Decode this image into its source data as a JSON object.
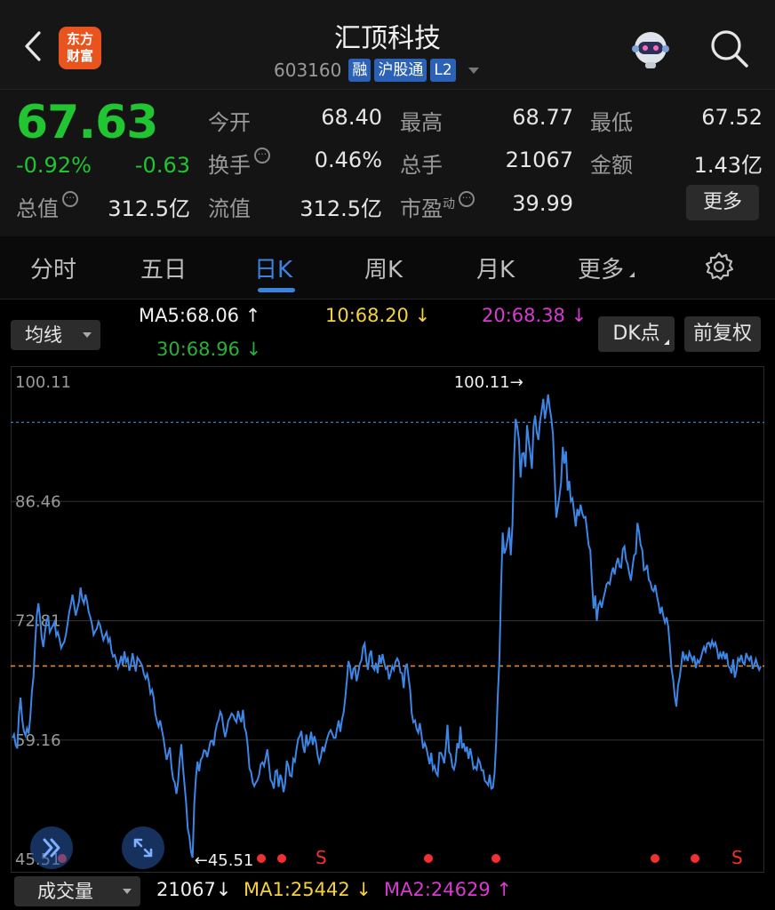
{
  "header": {
    "title": "汇顶科技",
    "code": "603160",
    "tags": [
      "融",
      "沪股通",
      "L2"
    ],
    "logo_text_line1": "东方",
    "logo_text_line2": "财富"
  },
  "quote": {
    "price": "67.63",
    "change_pct": "-0.92%",
    "change": "-0.63",
    "open_label": "今开",
    "open": "68.40",
    "high_label": "最高",
    "high": "68.77",
    "low_label": "最低",
    "low": "67.52",
    "turnover_label": "换手",
    "turnover": "0.46%",
    "volume_label": "总手",
    "volume": "21067",
    "amount_label": "金额",
    "amount": "1.43亿",
    "mktcap_label": "总值",
    "mktcap": "312.5亿",
    "float_label": "流值",
    "float": "312.5亿",
    "pe_label": "市盈",
    "pe_sup": "动",
    "pe": "39.99",
    "more_button": "更多"
  },
  "tabs": [
    "分时",
    "五日",
    "日K",
    "周K",
    "月K",
    "更多"
  ],
  "active_tab": "日K",
  "indicators": {
    "ma_select": "均线",
    "ma5": "MA5:68.06 ↑",
    "ma10": "10:68.20 ↓",
    "ma20": "20:68.38 ↓",
    "ma30": "30:68.96 ↓",
    "dk_button": "DK点",
    "adjust_button": "前复权"
  },
  "chart_data": {
    "type": "line",
    "y_ticks": [
      "100.11",
      "86.46",
      "72.81",
      "59.16",
      "45.51"
    ],
    "ylim": [
      45.51,
      100.11
    ],
    "max_label": "100.11→",
    "min_label": "←45.51",
    "last": 67.63,
    "ref_line": 95.5,
    "signals": [
      "•",
      "•",
      "•",
      "S",
      "•",
      "•",
      "•",
      "•",
      "S"
    ],
    "values": [
      59.4,
      59.8,
      58.6,
      58.2,
      62.1,
      64.0,
      61.5,
      60.2,
      59.7,
      60.5,
      59.9,
      61.8,
      64.7,
      66.4,
      70.3,
      73.4,
      74.8,
      73.2,
      70.9,
      69.8,
      71.4,
      72.8,
      73.3,
      71.5,
      71.9,
      72.3,
      72.7,
      71.1,
      71.5,
      70.7,
      69.7,
      70.1,
      70.4,
      71.3,
      72.5,
      73.8,
      74.7,
      75.8,
      74.6,
      73.4,
      74.2,
      75.0,
      76.6,
      75.3,
      74.8,
      75.8,
      75.0,
      73.8,
      73.2,
      72.4,
      71.2,
      71.6,
      71.9,
      72.7,
      72.3,
      71.4,
      70.6,
      71.1,
      71.5,
      70.4,
      70.8,
      69.4,
      68.7,
      68.9,
      68.2,
      67.4,
      67.9,
      68.8,
      67.7,
      69.3,
      68.1,
      68.5,
      67.1,
      67.8,
      69.1,
      68.0,
      67.0,
      68.6,
      68.3,
      68.0,
      67.6,
      66.7,
      66.2,
      66.7,
      65.9,
      64.5,
      64.9,
      64.0,
      62.2,
      61.3,
      60.7,
      61.4,
      60.4,
      59.4,
      58.1,
      56.9,
      57.6,
      58.3,
      56.0,
      54.7,
      54.3,
      53.0,
      54.3,
      56.8,
      58.7,
      56.1,
      54.1,
      52.0,
      49.0,
      48.1,
      46.4,
      45.7,
      51.9,
      54.8,
      56.7,
      55.6,
      56.9,
      57.2,
      58.0,
      57.9,
      57.2,
      58.1,
      59.0,
      59.1,
      58.5,
      60.1,
      61.0,
      61.5,
      62.4,
      62.0,
      60.6,
      59.5,
      60.3,
      61.4,
      61.7,
      62.2,
      62.0,
      61.5,
      61.2,
      62.5,
      61.7,
      61.2,
      62.6,
      60.6,
      60.0,
      58.4,
      55.9,
      55.5,
      54.3,
      53.9,
      54.3,
      54.6,
      55.2,
      56.4,
      56.6,
      56.2,
      57.1,
      58.1,
      56.4,
      54.6,
      54.3,
      53.6,
      55.6,
      55.7,
      53.8,
      55.2,
      54.6,
      53.2,
      54.2,
      56.8,
      56.2,
      55.1,
      55.0,
      57.0,
      56.7,
      58.1,
      59.3,
      59.6,
      60.2,
      58.5,
      57.7,
      59.8,
      58.6,
      58.9,
      60.1,
      58.6,
      59.6,
      58.9,
      57.4,
      56.6,
      57.2,
      58.4,
      57.8,
      58.7,
      59.4,
      60.0,
      60.3,
      59.9,
      59.4,
      59.4,
      60.5,
      61.4,
      60.1,
      61.5,
      62.3,
      63.9,
      66.0,
      68.2,
      67.5,
      66.1,
      67.3,
      67.5,
      65.9,
      66.8,
      67.9,
      68.3,
      69.8,
      70.2,
      68.2,
      67.2,
      68.9,
      69.4,
      67.5,
      67.2,
      68.0,
      66.8,
      68.9,
      67.9,
      69.0,
      68.0,
      67.3,
      67.5,
      66.1,
      66.8,
      67.6,
      67.2,
      68.1,
      68.5,
      68.1,
      66.9,
      66.8,
      65.1,
      67.4,
      67.9,
      66.3,
      64.9,
      62.2,
      61.2,
      61.4,
      60.4,
      60.0,
      61.1,
      59.7,
      58.2,
      58.8,
      58.3,
      57.3,
      56.4,
      57.7,
      55.8,
      56.2,
      55.4,
      55.1,
      57.7,
      57.7,
      57.2,
      56.5,
      58.4,
      60.9,
      57.8,
      57.5,
      56.1,
      55.8,
      56.6,
      58.8,
      58.2,
      60.7,
      58.2,
      58.8,
      57.8,
      58.4,
      57.0,
      58.2,
      57.2,
      55.9,
      56.1,
      55.8,
      57.0,
      56.6,
      55.7,
      55.7,
      54.5,
      54.3,
      54.0,
      55.2,
      53.6,
      53.7,
      55.4,
      59.0,
      64.2,
      68.3,
      76.6,
      82.9,
      80.5,
      81.0,
      82.1,
      83.5,
      80.3,
      83.8,
      91.3,
      95.9,
      95.0,
      93.5,
      89.2,
      91.9,
      92.0,
      90.4,
      95.2,
      93.4,
      92.0,
      90.2,
      95.0,
      96.3,
      94.4,
      93.5,
      95.6,
      96.8,
      98.2,
      95.9,
      97.1,
      98.7,
      97.1,
      95.9,
      94.1,
      89.5,
      84.6,
      85.8,
      87.1,
      88.6,
      92.7,
      90.8,
      92.2,
      87.7,
      88.8,
      86.5,
      86.8,
      85.2,
      83.6,
      85.6,
      84.8,
      86.1,
      85.1,
      84.6,
      84.7,
      83.0,
      81.4,
      80.9,
      77.4,
      74.2,
      75.7,
      72.8,
      74.6,
      75.0,
      74.3,
      75.3,
      76.1,
      77.0,
      77.2,
      77.0,
      78.2,
      78.9,
      78.1,
      79.3,
      80.0,
      79.0,
      78.9,
      81.0,
      81.3,
      79.8,
      79.3,
      78.2,
      77.4,
      79.0,
      80.3,
      80.5,
      84.0,
      83.0,
      81.5,
      80.9,
      78.6,
      78.7,
      79.2,
      77.5,
      77.2,
      76.4,
      76.2,
      76.9,
      75.7,
      74.8,
      73.6,
      74.4,
      73.3,
      72.6,
      73.2,
      72.1,
      69.9,
      67.4,
      66.1,
      64.2,
      63.0,
      65.4,
      66.3,
      67.7,
      69.3,
      68.4,
      68.8,
      68.2,
      69.2,
      68.7,
      68.2,
      68.8,
      67.4,
      68.3,
      68.0,
      68.5,
      69.2,
      69.8,
      69.3,
      70.2,
      70.3,
      69.8,
      70.5,
      69.9,
      70.3,
      69.6,
      68.4,
      69.1,
      68.6,
      69.3,
      68.4,
      69.1,
      67.6,
      67.4,
      66.8,
      68.4,
      66.3,
      67.1,
      68.5,
      68.2,
      68.9,
      68.0,
      67.8,
      69.1,
      68.6,
      68.3,
      68.8,
      67.3,
      67.8,
      68.4,
      67.7,
      67.2,
      67.6
    ]
  },
  "volume": {
    "select": "成交量",
    "value": "21067↓",
    "ma1": "MA1:25442 ↓",
    "ma2": "MA2:24629 ↑"
  }
}
